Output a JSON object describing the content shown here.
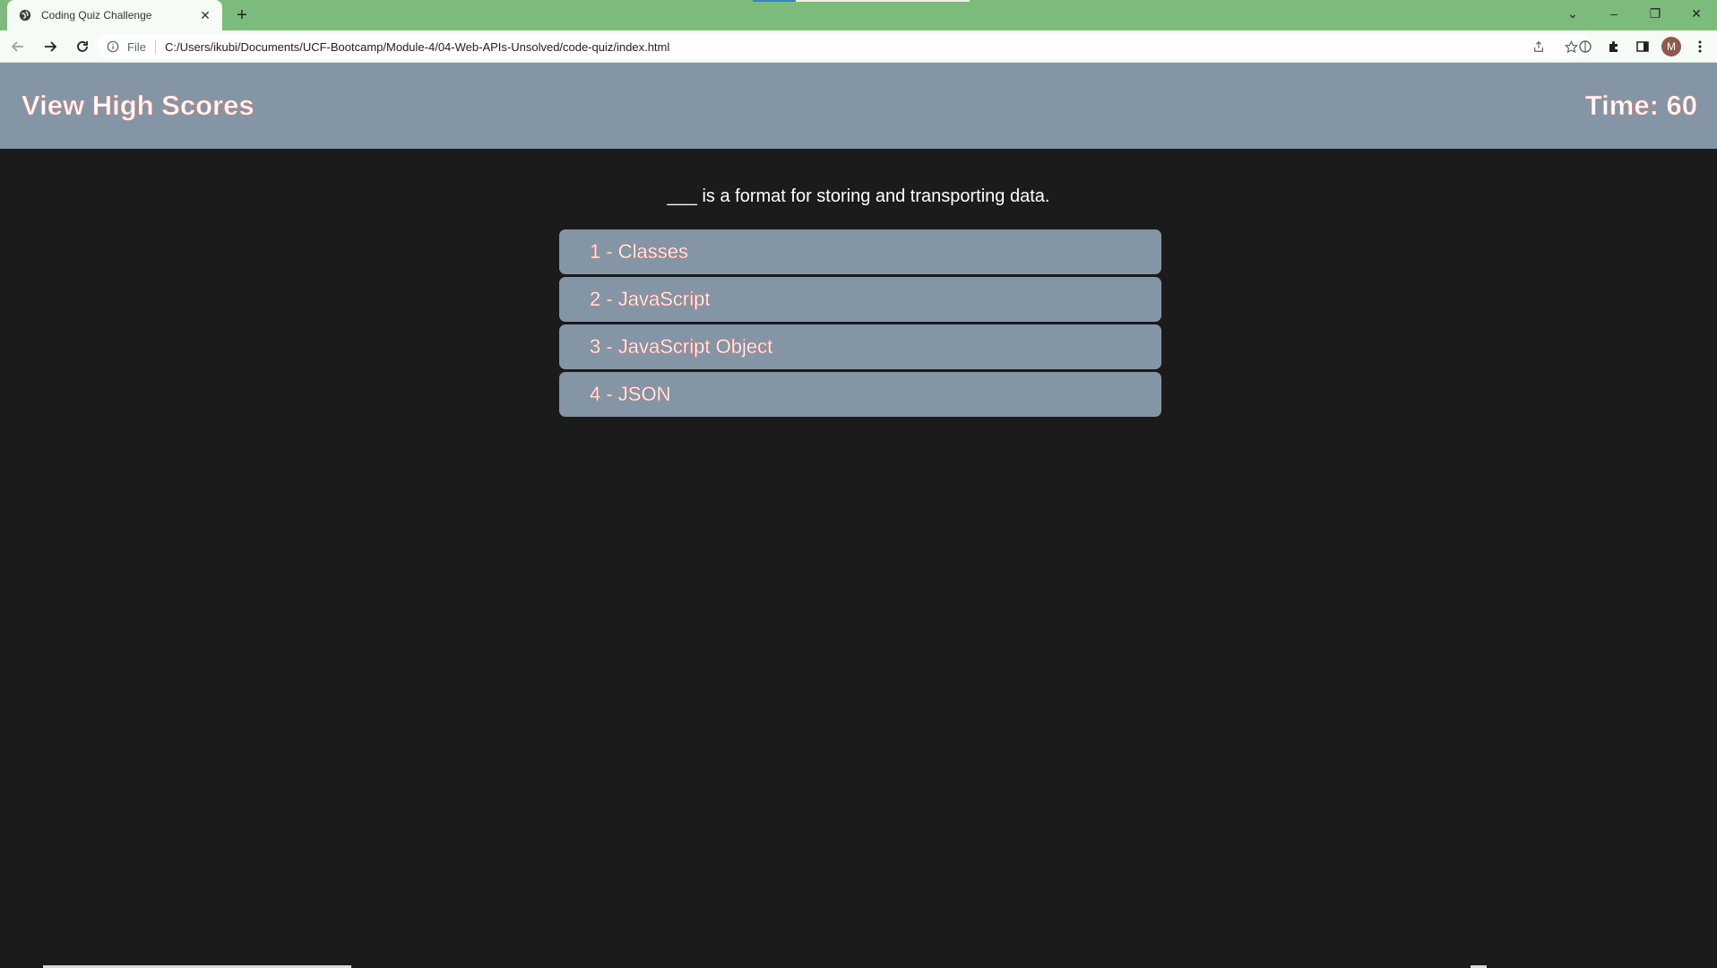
{
  "browser": {
    "tab_title": "Coding Quiz Challenge",
    "tab_close": "✕",
    "new_tab": "+",
    "address_scheme": "File",
    "url": "C:/Users/ikubi/Documents/UCF-Bootcamp/Module-4/04-Web-APIs-Unsolved/code-quiz/index.html",
    "profile_initial": "M",
    "window_controls": {
      "dropdown": "⌄",
      "minimize": "–",
      "restore": "❐",
      "close": "✕"
    }
  },
  "header": {
    "view_scores_label": "View High Scores",
    "timer_label": "Time: 60"
  },
  "quiz": {
    "question": "___ is a format for storing and transporting data.",
    "answers": [
      {
        "label": "1 - Classes"
      },
      {
        "label": "2 - JavaScript"
      },
      {
        "label": "3 - JavaScript Object"
      },
      {
        "label": "4 - JSON"
      }
    ]
  },
  "colors": {
    "header_bg": "#8496a6",
    "page_bg": "#1b1b1b",
    "text_outline": "#e9766b",
    "tabbar_bg": "#7dbb7c"
  }
}
